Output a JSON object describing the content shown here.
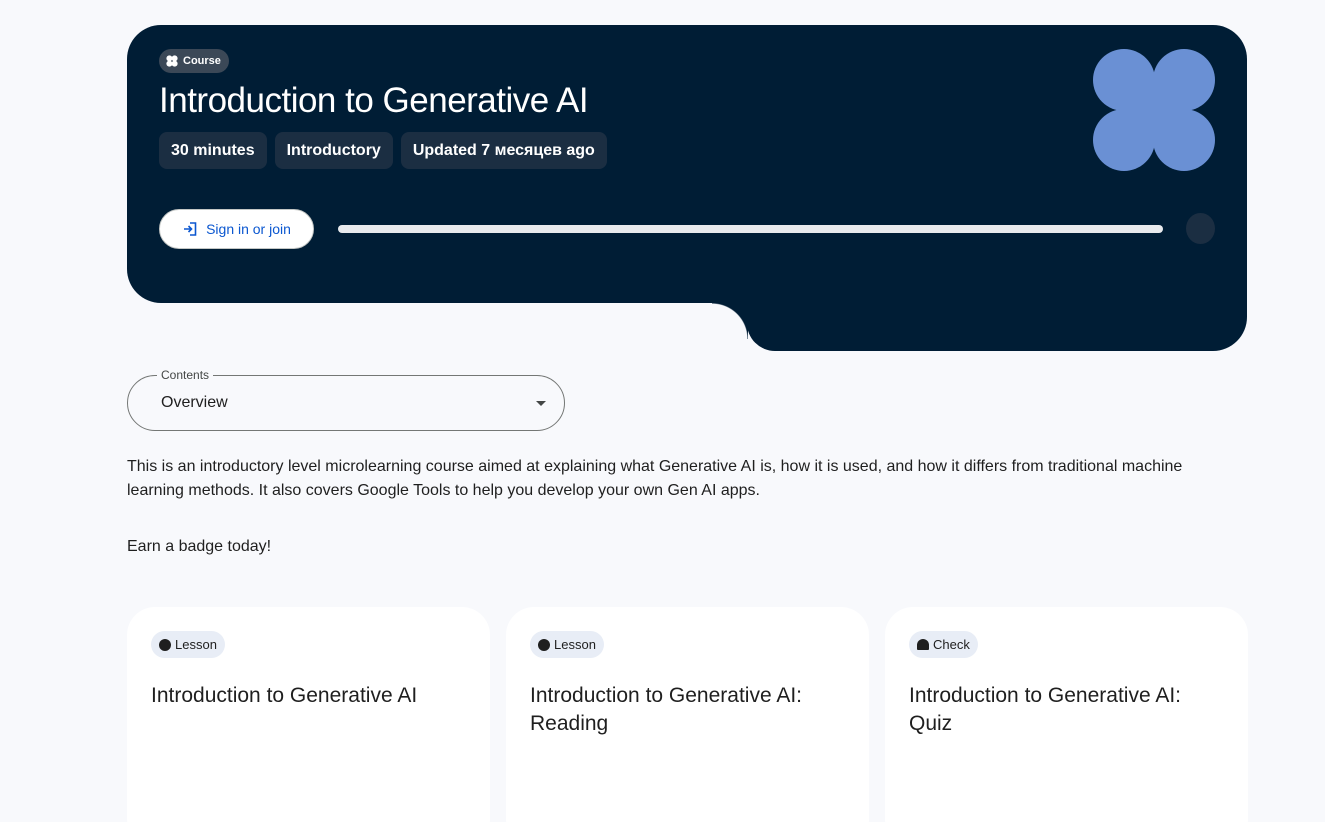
{
  "hero": {
    "chip": "Course",
    "title": "Introduction to Generative AI",
    "meta": [
      "30 minutes",
      "Introductory",
      "Updated 7 месяцев ago"
    ],
    "signin_label": "Sign in or join",
    "progress": 0
  },
  "contents": {
    "legend": "Contents",
    "selected": "Overview"
  },
  "description": "This is an introductory level microlearning course aimed at explaining what Generative AI is, how it is used, and how it differs from traditional machine learning methods. It also covers Google Tools to help you develop your own Gen AI apps.",
  "earn": "Earn a badge today!",
  "cards": [
    {
      "chip": "Lesson",
      "icon": "dot-icon",
      "title": "Introduction to Generative AI"
    },
    {
      "chip": "Lesson",
      "icon": "dot-icon",
      "title": "Introduction to Generative AI: Reading"
    },
    {
      "chip": "Check",
      "icon": "check-icon",
      "title": "Introduction to Generative AI: Quiz"
    }
  ],
  "colors": {
    "hero_bg": "#001d35",
    "logo": "#6a90d4",
    "accent": "#0b57d0",
    "page_bg": "#f8f9fc"
  }
}
